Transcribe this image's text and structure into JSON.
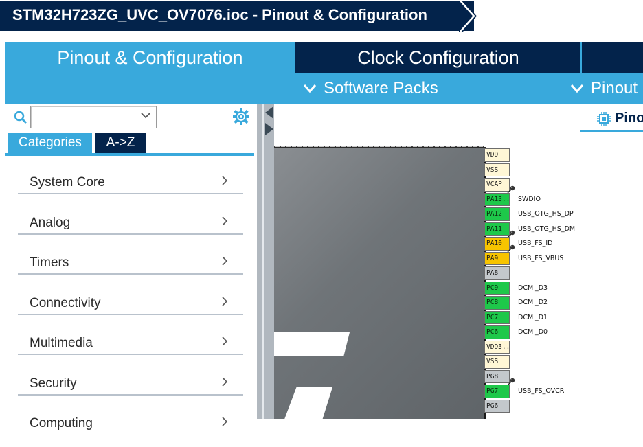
{
  "window": {
    "title": "STM32H723ZG_UVC_OV7076.ioc - Pinout & Configuration"
  },
  "main_tabs": [
    {
      "label": "Pinout & Configuration",
      "active": true
    },
    {
      "label": "Clock Configuration",
      "active": false
    }
  ],
  "submenu": [
    {
      "label": "Software Packs",
      "icon": "chevron-down-icon"
    },
    {
      "label": "Pinout",
      "icon": "chevron-down-icon"
    }
  ],
  "left_panel": {
    "search": {
      "value": "",
      "placeholder": ""
    },
    "view_tabs": [
      {
        "label": "Categories",
        "active": true
      },
      {
        "label": "A->Z",
        "active": false
      }
    ],
    "categories": [
      {
        "label": "System Core"
      },
      {
        "label": "Analog"
      },
      {
        "label": "Timers"
      },
      {
        "label": "Connectivity"
      },
      {
        "label": "Multimedia"
      },
      {
        "label": "Security"
      },
      {
        "label": "Computing"
      }
    ]
  },
  "canvas": {
    "view_tab": "Pinout view",
    "pins": [
      {
        "name": "VDD",
        "kind": "power",
        "signal": ""
      },
      {
        "name": "VSS",
        "kind": "power",
        "signal": ""
      },
      {
        "name": "VCAP",
        "kind": "power",
        "signal": "",
        "pinned": true
      },
      {
        "name": "PA13..",
        "kind": "green",
        "signal": "SWDIO"
      },
      {
        "name": "PA12",
        "kind": "green",
        "signal": "USB_OTG_HS_DP"
      },
      {
        "name": "PA11",
        "kind": "green",
        "signal": "USB_OTG_HS_DM",
        "pinned": true
      },
      {
        "name": "PA10",
        "kind": "yellow",
        "signal": "USB_FS_ID",
        "pinned": true
      },
      {
        "name": "PA9",
        "kind": "yellow",
        "signal": "USB_FS_VBUS"
      },
      {
        "name": "PA8",
        "kind": "gray",
        "signal": ""
      },
      {
        "name": "PC9",
        "kind": "green",
        "signal": "DCMI_D3"
      },
      {
        "name": "PC8",
        "kind": "green",
        "signal": "DCMI_D2"
      },
      {
        "name": "PC7",
        "kind": "green",
        "signal": "DCMI_D1"
      },
      {
        "name": "PC6",
        "kind": "green",
        "signal": "DCMI_D0"
      },
      {
        "name": "VDD3..",
        "kind": "power",
        "signal": ""
      },
      {
        "name": "VSS",
        "kind": "power",
        "signal": ""
      },
      {
        "name": "PG8",
        "kind": "gray",
        "signal": "",
        "pinned": true
      },
      {
        "name": "PG7",
        "kind": "green",
        "signal": "USB_FS_OVCR"
      },
      {
        "name": "PG6",
        "kind": "gray",
        "signal": ""
      }
    ]
  },
  "colors": {
    "navy": "#03234b",
    "accent_blue": "#39a9dc",
    "pin_green": "#1ec84a",
    "pin_yellow": "#f7c400",
    "pin_gray": "#c3c8cc",
    "pin_power": "#fff7d6"
  }
}
